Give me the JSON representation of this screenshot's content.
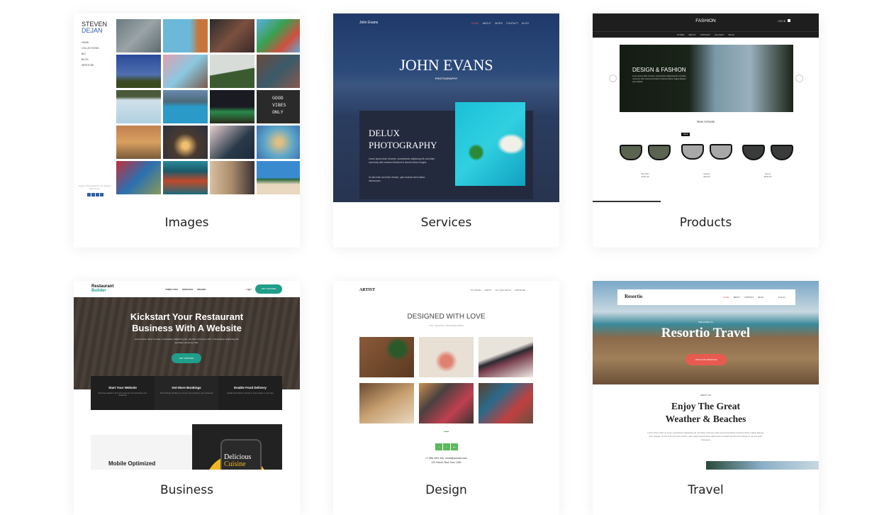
{
  "colors": {
    "accent_teal": "#1f9e8a",
    "accent_red": "#e85a4f",
    "accent_green": "#5cb85c",
    "dejan_blue": "#2d5ea8"
  },
  "templates": [
    {
      "label": "Images",
      "preview": {
        "brand_line1": "STEVEN",
        "brand_line2": "DEJAN",
        "nav": [
          "HOME",
          "COLLECTIONS",
          "BIO",
          "BLOG",
          "WRITE ME"
        ],
        "photo_text": [
          "GOOD",
          "VIBES",
          "ONLY"
        ],
        "footer": "Dejan Photography. All Rights Reserved.",
        "social_icons": [
          "facebook-icon",
          "instagram-icon",
          "pinterest-icon",
          "email-icon"
        ]
      }
    },
    {
      "label": "Services",
      "preview": {
        "brand": "John Evans",
        "nav": [
          "HOME",
          "ABOUT",
          "WORK",
          "CONTACT",
          "BLOG"
        ],
        "title": "JOHN EVANS",
        "subtitle": "PHOTOGRAPHY",
        "section_title_1": "DELUX",
        "section_title_2": "PHOTOGRAPHY",
        "para1": "Lorem ipsum dolor sit amet, consectetuer adipiscing elit, sed diam nonummy nibh euismod tincidunt ut laoreet dolore magna.",
        "para2": "Ut wisi enim ad minim veniam, quis nostrud exerci tation ullamcorper."
      }
    },
    {
      "label": "Products",
      "preview": {
        "brand": "FASHION",
        "login": "LOG IN",
        "nav": [
          "STORE",
          "ABOUT",
          "CONTACT",
          "GALLERY",
          "BLOG"
        ],
        "hero_title": "DESIGN & FASHION",
        "hero_text": "Lorem ipsum dolor sit amet, consectetuer adipiscing elit, sed diam nonummy nibh euismod tincidunt ut laoreet dolore magna aliquam erat volutpat.",
        "section": "New Arrivals",
        "sale": "SALE",
        "products": [
          {
            "name": "Ray-Ban",
            "price": "$150.00"
          },
          {
            "name": "Oakley",
            "price": "$99.00"
          },
          {
            "name": "Persol",
            "price": "$200.00"
          }
        ]
      }
    },
    {
      "label": "Business",
      "preview": {
        "brand_line1": "Restaurant",
        "brand_line2": "Builder",
        "nav": [
          "TEMPLATES",
          "SERVICES",
          "PRICING"
        ],
        "login": "Login",
        "cta": "GET STARTED",
        "hero_title_1": "Kickstart Your Restaurant",
        "hero_title_2": "Business With A Website",
        "hero_text": "Lorem ipsum dolor sit amet, consectetuer adipiscing elit, sed diam nonummy nibh. Consectetuer adipiscing elit, sed diam nonummy nibh.",
        "features": [
          {
            "title": "Start Your Website",
            "text": "Stunning website to find new customers and showcase your restaurant"
          },
          {
            "title": "Get More Bookings",
            "text": "The bookings will allow you to get more people to your restaurant"
          },
          {
            "title": "Enable Food Delivery",
            "text": "Enable food delivery and get to more people in your area"
          }
        ],
        "section": "Mobile Optimized",
        "phone_text_1": "Delicious",
        "phone_text_2": "Cuisine"
      }
    },
    {
      "label": "Design",
      "preview": {
        "brand": "ARTIST",
        "nav": [
          "MY WORK",
          "ABOUT",
          "MY THOUGHTS",
          "WRITE ME"
        ],
        "title": "DESIGNED WITH LOVE",
        "subtitle": "FUN, AMAZING, UNFORGETTABLE",
        "social": [
          "f",
          "t",
          "g+"
        ],
        "contact_1": "+1 388 1501 332, email@domain.com",
        "contact_2": "123 Street, New York, USA"
      }
    },
    {
      "label": "Travel",
      "preview": {
        "brand": "Resortio",
        "nav": [
          "HOME",
          "ABOUT",
          "CONTACT",
          "BLOG"
        ],
        "login": "LOG IN",
        "welcome": "WELCOME TO",
        "title": "Resortio Travel",
        "cta": "VIEW OUR SERVICES",
        "about": "ABOUT US",
        "heading_1": "Enjoy The Great",
        "heading_2": "Weather & Beaches",
        "text": "Lorem ipsum dolor sit amet, consectetuer adipiscing elit, sed diam nonummy nibh euismod tincidunt ut laoreet dolore magna aliquam erat volutpat. Ut wisi enim ad minim veniam, quis nostrud exerci tation ullamcorper suscipit lobortis nisl ut aliquip ex ea commodo consequat."
      }
    }
  ]
}
